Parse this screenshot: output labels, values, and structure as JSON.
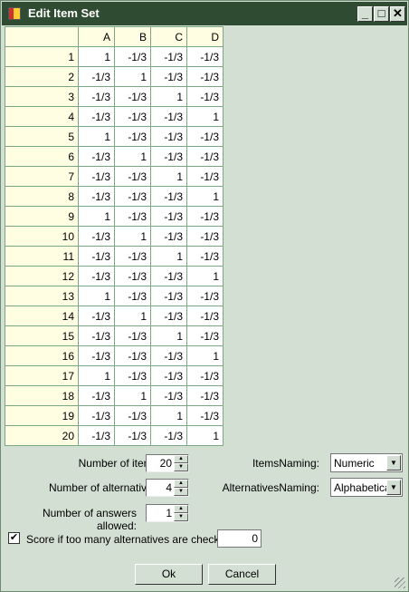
{
  "window": {
    "title": "Edit Item Set",
    "minimize": "_",
    "maximize": "□",
    "close": "✕"
  },
  "grid": {
    "columns": [
      "A",
      "B",
      "C",
      "D"
    ],
    "rows": [
      {
        "label": "1",
        "values": [
          "1",
          "-1/3",
          "-1/3",
          "-1/3"
        ]
      },
      {
        "label": "2",
        "values": [
          "-1/3",
          "1",
          "-1/3",
          "-1/3"
        ]
      },
      {
        "label": "3",
        "values": [
          "-1/3",
          "-1/3",
          "1",
          "-1/3"
        ]
      },
      {
        "label": "4",
        "values": [
          "-1/3",
          "-1/3",
          "-1/3",
          "1"
        ]
      },
      {
        "label": "5",
        "values": [
          "1",
          "-1/3",
          "-1/3",
          "-1/3"
        ]
      },
      {
        "label": "6",
        "values": [
          "-1/3",
          "1",
          "-1/3",
          "-1/3"
        ]
      },
      {
        "label": "7",
        "values": [
          "-1/3",
          "-1/3",
          "1",
          "-1/3"
        ]
      },
      {
        "label": "8",
        "values": [
          "-1/3",
          "-1/3",
          "-1/3",
          "1"
        ]
      },
      {
        "label": "9",
        "values": [
          "1",
          "-1/3",
          "-1/3",
          "-1/3"
        ]
      },
      {
        "label": "10",
        "values": [
          "-1/3",
          "1",
          "-1/3",
          "-1/3"
        ]
      },
      {
        "label": "11",
        "values": [
          "-1/3",
          "-1/3",
          "1",
          "-1/3"
        ]
      },
      {
        "label": "12",
        "values": [
          "-1/3",
          "-1/3",
          "-1/3",
          "1"
        ]
      },
      {
        "label": "13",
        "values": [
          "1",
          "-1/3",
          "-1/3",
          "-1/3"
        ]
      },
      {
        "label": "14",
        "values": [
          "-1/3",
          "1",
          "-1/3",
          "-1/3"
        ]
      },
      {
        "label": "15",
        "values": [
          "-1/3",
          "-1/3",
          "1",
          "-1/3"
        ]
      },
      {
        "label": "16",
        "values": [
          "-1/3",
          "-1/3",
          "-1/3",
          "1"
        ]
      },
      {
        "label": "17",
        "values": [
          "1",
          "-1/3",
          "-1/3",
          "-1/3"
        ]
      },
      {
        "label": "18",
        "values": [
          "-1/3",
          "1",
          "-1/3",
          "-1/3"
        ]
      },
      {
        "label": "19",
        "values": [
          "-1/3",
          "-1/3",
          "1",
          "-1/3"
        ]
      },
      {
        "label": "20",
        "values": [
          "-1/3",
          "-1/3",
          "-1/3",
          "1"
        ]
      }
    ]
  },
  "form": {
    "num_items_label": "Number of items:",
    "num_items": "20",
    "num_alts_label": "Number of alternatives:",
    "num_alts": "4",
    "num_answers_label": "Number of answers allowed:",
    "num_answers": "1",
    "items_naming_label": "ItemsNaming:",
    "items_naming": "Numeric",
    "alts_naming_label": "AlternativesNaming:",
    "alts_naming": "Alphabetical",
    "score_checked": true,
    "score_label": "Score if too many alternatives are checked:",
    "score_value": "0",
    "ok": "Ok",
    "cancel": "Cancel"
  }
}
